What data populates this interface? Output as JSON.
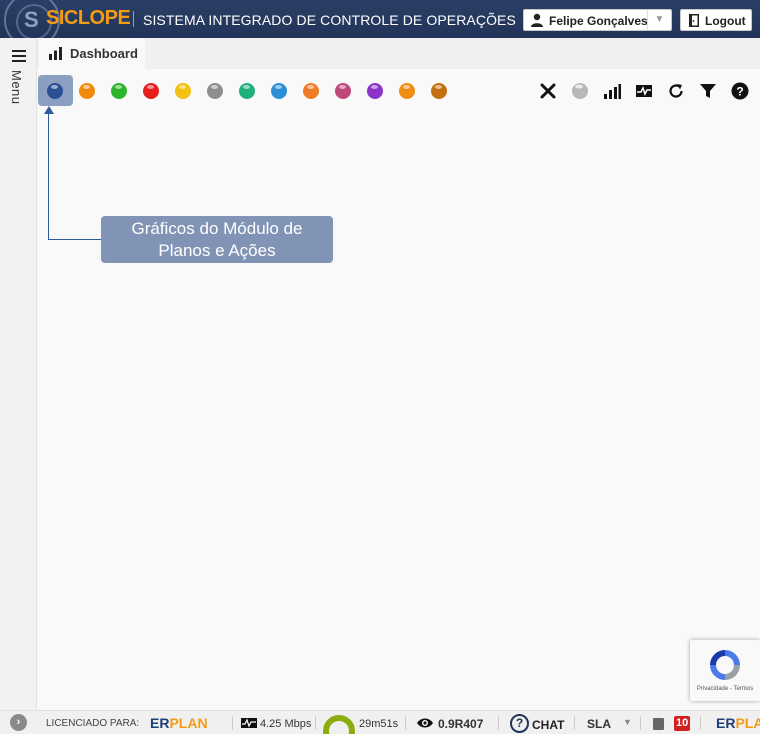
{
  "header": {
    "brand": "SICLOPE",
    "subtitle": "SISTEMA INTEGRADO DE CONTROLE DE OPERAÇÕES",
    "user_name": "Felipe Gonçalves",
    "logout_label": "Logout",
    "brand_color": "#f39c12",
    "bar_color": "#223458"
  },
  "sidebar": {
    "menu_label": "Menu"
  },
  "tabs": [
    {
      "label": "Dashboard",
      "icon": "bar-chart-icon",
      "active": true
    }
  ],
  "modules": [
    {
      "name": "module-1",
      "color": "#2a4f94",
      "selected": true
    },
    {
      "name": "module-2",
      "color": "#f08a0c"
    },
    {
      "name": "module-3",
      "color": "#2bb52b"
    },
    {
      "name": "module-4",
      "color": "#e61e1e"
    },
    {
      "name": "module-5",
      "color": "#f4c011"
    },
    {
      "name": "module-6",
      "color": "#8e8e8e"
    },
    {
      "name": "module-7",
      "color": "#1fb07a"
    },
    {
      "name": "module-8",
      "color": "#2d8ed8"
    },
    {
      "name": "module-9",
      "color": "#f07c2a"
    },
    {
      "name": "module-10",
      "color": "#c0487a"
    },
    {
      "name": "module-11",
      "color": "#8b34c8"
    },
    {
      "name": "module-12",
      "color": "#f08c14"
    },
    {
      "name": "module-13",
      "color": "#c56f10"
    }
  ],
  "toolbar": [
    {
      "name": "close-icon"
    },
    {
      "name": "gray-ball-icon"
    },
    {
      "name": "signal-bars-icon"
    },
    {
      "name": "activity-monitor-icon"
    },
    {
      "name": "refresh-icon"
    },
    {
      "name": "filter-icon"
    },
    {
      "name": "help-icon"
    }
  ],
  "callout": {
    "line1": "Gráficos do Módulo de",
    "line2": "Planos e Ações"
  },
  "recaptcha": {
    "text": "Privacidade - Termos"
  },
  "footer": {
    "licensed_label": "LICENCIADO PARA:",
    "brand_er": "ER",
    "brand_plan": "PLAN",
    "speed": "4.25 Mbps",
    "session_time": "29m51s",
    "version": "0.9R407",
    "chat_label": "CHAT",
    "sla_label": "SLA",
    "notification_count": "10"
  }
}
